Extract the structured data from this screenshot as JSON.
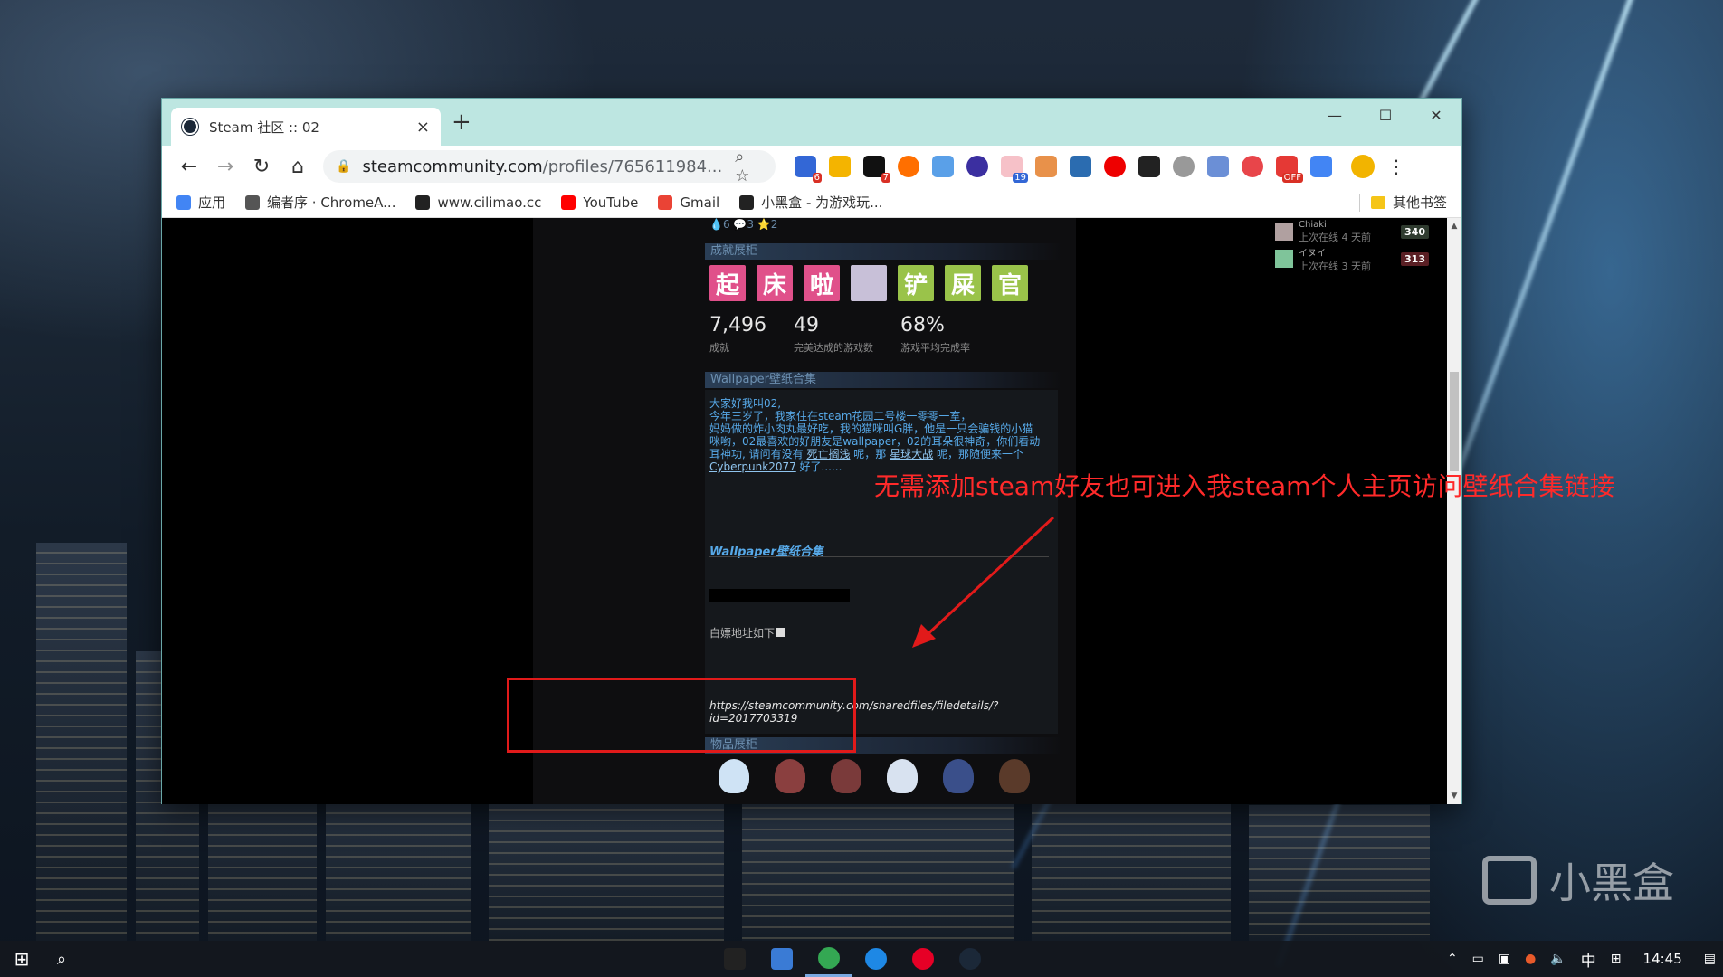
{
  "browser": {
    "tab_title": "Steam 社区 :: 02",
    "tab_close": "×",
    "new_tab": "+",
    "win_minimize": "—",
    "win_maximize": "☐",
    "win_close": "✕",
    "url_host": "steamcommunity.com",
    "url_path": "/profiles/765611984...",
    "ext_badges": [
      "6",
      "7",
      "19",
      "OFF"
    ],
    "bookmarks": [
      {
        "label": "应用",
        "icon": "apps-grid-icon",
        "color": "#4285f4"
      },
      {
        "label": "编者序 · ChromeA...",
        "icon": "book-icon",
        "color": "#555555"
      },
      {
        "label": "www.cilimao.cc",
        "icon": "cat-icon",
        "color": "#222222"
      },
      {
        "label": "YouTube",
        "icon": "youtube-icon",
        "color": "#ff0000"
      },
      {
        "label": "Gmail",
        "icon": "gmail-icon",
        "color": "#ea4335"
      },
      {
        "label": "小黑盒 - 为游戏玩...",
        "icon": "heybox-icon",
        "color": "#222222"
      }
    ],
    "other_bookmarks": "其他书签"
  },
  "profile": {
    "top_stats": "💧6  💬3  ⭐2",
    "achievements_head": "成就展柜",
    "badge_tiles": [
      {
        "char": "起",
        "color": "#e0508a"
      },
      {
        "char": "床",
        "color": "#e0508a"
      },
      {
        "char": "啦",
        "color": "#e0508a"
      },
      {
        "char": "",
        "color": "#c8c0d8"
      },
      {
        "char": "铲",
        "color": "#9ac34a"
      },
      {
        "char": "屎",
        "color": "#9ac34a"
      },
      {
        "char": "官",
        "color": "#9ac34a"
      }
    ],
    "ach_stats": [
      {
        "value": "7,496",
        "label": "成就"
      },
      {
        "value": "49",
        "label": "完美达成的游戏数"
      },
      {
        "value": "68%",
        "label": "游戏平均完成率"
      }
    ],
    "wallpaper_head": "Wallpaper壁纸合集",
    "intro_lines": [
      "大家好我叫02,",
      "今年三岁了，我家住在steam花园二号楼一零零一室，",
      "妈妈做的炸小肉丸最好吃，我的猫咪叫G胖，他是一只会骗钱的小猫",
      "咪哟，02最喜欢的好朋友是wallpaper，02的耳朵很神奇，你们看动"
    ],
    "intro_line5_a": "耳神功, 请问有没有 ",
    "intro_link1": "死亡搁浅",
    "intro_line5_b": " 呢，那 ",
    "intro_link2": "星球大战",
    "intro_line5_c": " 呢，那随便来一个",
    "intro_link3": "Cyberpunk2077",
    "intro_line6_b": " 好了......",
    "collection_title": "Wallpaper壁纸合集",
    "address_note": "白嫖地址如下",
    "collection_url": "https://steamcommunity.com/sharedfiles/filedetails/?id=2017703319",
    "gallery_head": "物品展柜"
  },
  "friends": [
    {
      "name": "Chiaki",
      "status": "上次在线 4 天前",
      "level": "340",
      "level_color": "#2f3b2f"
    },
    {
      "name": "イヌイ",
      "status": "上次在线 3 天前",
      "level": "313",
      "level_color": "#5a1f24"
    }
  ],
  "annotation": "无需添加steam好友也可进入我steam个人主页访问壁纸合集链接",
  "watermark": "小黑盒",
  "taskbar": {
    "clock": "14:45",
    "ime": "中",
    "apps": [
      {
        "icon": "terminal-icon",
        "color": "#222222"
      },
      {
        "icon": "store-icon",
        "color": "#3a7bd5"
      },
      {
        "icon": "chrome-icon",
        "color": "#34a853"
      },
      {
        "icon": "edge-icon",
        "color": "#1e88e5"
      },
      {
        "icon": "netease-music-icon",
        "color": "#e60026"
      },
      {
        "icon": "steam-icon",
        "color": "#1b2838"
      }
    ]
  }
}
